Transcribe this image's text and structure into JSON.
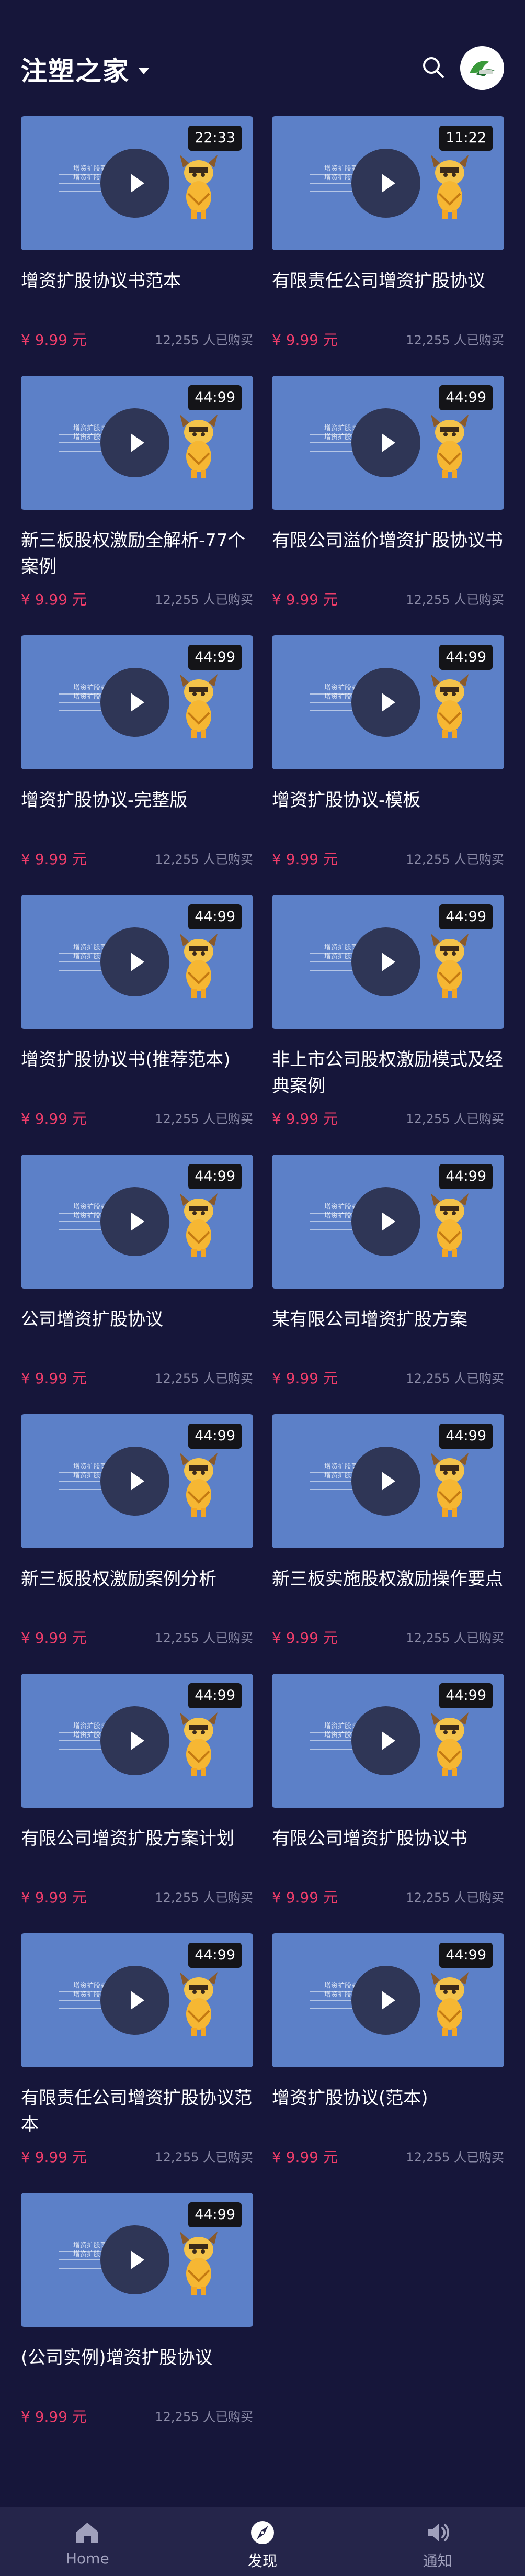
{
  "header": {
    "title": "注塑之家",
    "search_icon": "search-icon",
    "avatar_icon": "logo-avatar"
  },
  "colors": {
    "background": "#16163a",
    "thumb": "#5c80c8",
    "price": "#ef3d6a",
    "muted": "#8a8aa6",
    "nav_bg": "#25254a"
  },
  "videos": [
    {
      "duration": "22:33",
      "title": "增资扩股协议书范本",
      "price": "¥ 9.99 元",
      "bought": "12,255 人已购买"
    },
    {
      "duration": "11:22",
      "title": "有限责任公司增资扩股协议",
      "price": "¥ 9.99 元",
      "bought": "12,255 人已购买"
    },
    {
      "duration": "44:99",
      "title": "新三板股权激励全解析-77个案例",
      "price": "¥ 9.99 元",
      "bought": "12,255 人已购买"
    },
    {
      "duration": "44:99",
      "title": "有限公司溢价增资扩股协议书",
      "price": "¥ 9.99 元",
      "bought": "12,255 人已购买"
    },
    {
      "duration": "44:99",
      "title": "增资扩股协议-完整版",
      "price": "¥ 9.99 元",
      "bought": "12,255 人已购买"
    },
    {
      "duration": "44:99",
      "title": "增资扩股协议-模板",
      "price": "¥ 9.99 元",
      "bought": "12,255 人已购买"
    },
    {
      "duration": "44:99",
      "title": "增资扩股协议书(推荐范本)",
      "price": "¥ 9.99 元",
      "bought": "12,255 人已购买"
    },
    {
      "duration": "44:99",
      "title": "非上市公司股权激励模式及经典案例",
      "price": "¥ 9.99 元",
      "bought": "12,255 人已购买"
    },
    {
      "duration": "44:99",
      "title": "公司增资扩股协议",
      "price": "¥ 9.99 元",
      "bought": "12,255 人已购买"
    },
    {
      "duration": "44:99",
      "title": "某有限公司增资扩股方案",
      "price": "¥ 9.99 元",
      "bought": "12,255 人已购买"
    },
    {
      "duration": "44:99",
      "title": "新三板股权激励案例分析",
      "price": "¥ 9.99 元",
      "bought": "12,255 人已购买"
    },
    {
      "duration": "44:99",
      "title": "新三板实施股权激励操作要点",
      "price": "¥ 9.99 元",
      "bought": "12,255 人已购买"
    },
    {
      "duration": "44:99",
      "title": "有限公司增资扩股方案计划",
      "price": "¥ 9.99 元",
      "bought": "12,255 人已购买"
    },
    {
      "duration": "44:99",
      "title": "有限公司增资扩股协议书",
      "price": "¥ 9.99 元",
      "bought": "12,255 人已购买"
    },
    {
      "duration": "44:99",
      "title": "有限责任公司增资扩股协议范本",
      "price": "¥ 9.99 元",
      "bought": "12,255 人已购买"
    },
    {
      "duration": "44:99",
      "title": "增资扩股协议(范本)",
      "price": "¥ 9.99 元",
      "bought": "12,255 人已购买"
    },
    {
      "duration": "44:99",
      "title": "(公司实例)增资扩股协议",
      "price": "¥ 9.99 元",
      "bought": "12,255 人已购买"
    }
  ],
  "thumbnail": {
    "line1": "增资扩股高质量扩股了",
    "line2": "增资扩股案例注意事项等细节"
  },
  "bottom_nav": [
    {
      "label": "Home",
      "icon": "home-icon",
      "active": false
    },
    {
      "label": "发现",
      "icon": "compass-icon",
      "active": true
    },
    {
      "label": "通知",
      "icon": "speaker-icon",
      "active": false
    }
  ]
}
